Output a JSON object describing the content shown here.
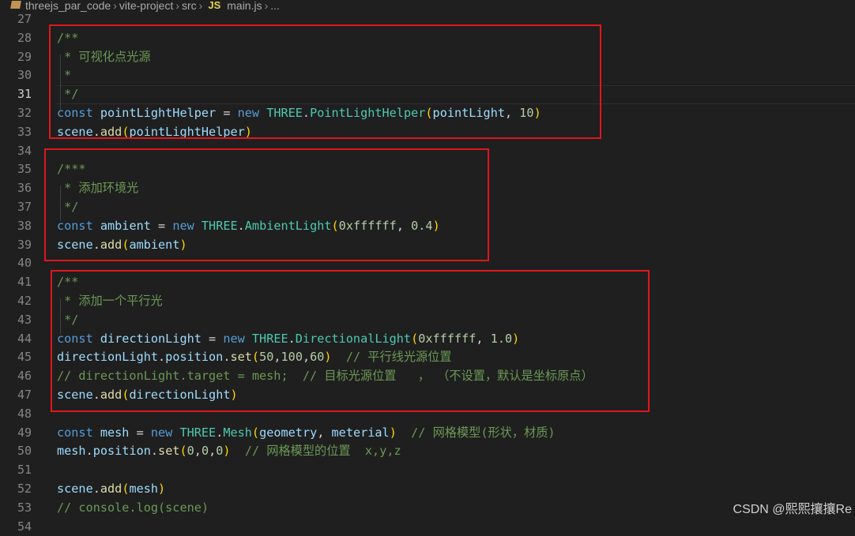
{
  "breadcrumb": {
    "project": "threejs_par_code",
    "folder": "vite-project",
    "subfolder": "src",
    "file_icon": "JS",
    "file": "main.js",
    "ellipsis": "..."
  },
  "editor": {
    "active_line": "31",
    "lines": [
      {
        "n": "27",
        "code": []
      },
      {
        "n": "28",
        "code": [
          [
            "c",
            "/**"
          ]
        ]
      },
      {
        "n": "29",
        "code": [
          [
            "c",
            " * 可视化点光源"
          ]
        ]
      },
      {
        "n": "30",
        "code": [
          [
            "c",
            " *"
          ]
        ]
      },
      {
        "n": "31",
        "code": [
          [
            "c",
            " */"
          ]
        ]
      },
      {
        "n": "32",
        "code": [
          [
            "k",
            "const "
          ],
          [
            "v",
            "pointLightHelper"
          ],
          [
            "o",
            " = "
          ],
          [
            "k",
            "new "
          ],
          [
            "t",
            "THREE"
          ],
          [
            "o",
            "."
          ],
          [
            "t",
            "PointLightHelper"
          ],
          [
            "p",
            "("
          ],
          [
            "v",
            "pointLight"
          ],
          [
            "o",
            ", "
          ],
          [
            "n",
            "10"
          ],
          [
            "p",
            ")"
          ]
        ]
      },
      {
        "n": "33",
        "code": [
          [
            "v",
            "scene"
          ],
          [
            "o",
            "."
          ],
          [
            "f",
            "add"
          ],
          [
            "p",
            "("
          ],
          [
            "v",
            "pointLightHelper"
          ],
          [
            "p",
            ")"
          ]
        ]
      },
      {
        "n": "34",
        "code": []
      },
      {
        "n": "35",
        "code": [
          [
            "c",
            "/***"
          ]
        ]
      },
      {
        "n": "36",
        "code": [
          [
            "c",
            " * 添加环境光"
          ]
        ]
      },
      {
        "n": "37",
        "code": [
          [
            "c",
            " */"
          ]
        ]
      },
      {
        "n": "38",
        "code": [
          [
            "k",
            "const "
          ],
          [
            "v",
            "ambient"
          ],
          [
            "o",
            " = "
          ],
          [
            "k",
            "new "
          ],
          [
            "t",
            "THREE"
          ],
          [
            "o",
            "."
          ],
          [
            "t",
            "AmbientLight"
          ],
          [
            "p",
            "("
          ],
          [
            "n",
            "0xffffff"
          ],
          [
            "o",
            ", "
          ],
          [
            "n",
            "0.4"
          ],
          [
            "p",
            ")"
          ]
        ]
      },
      {
        "n": "39",
        "code": [
          [
            "v",
            "scene"
          ],
          [
            "o",
            "."
          ],
          [
            "f",
            "add"
          ],
          [
            "p",
            "("
          ],
          [
            "v",
            "ambient"
          ],
          [
            "p",
            ")"
          ]
        ]
      },
      {
        "n": "40",
        "code": []
      },
      {
        "n": "41",
        "code": [
          [
            "c",
            "/**"
          ]
        ]
      },
      {
        "n": "42",
        "code": [
          [
            "c",
            " * 添加一个平行光"
          ]
        ]
      },
      {
        "n": "43",
        "code": [
          [
            "c",
            " */"
          ]
        ]
      },
      {
        "n": "44",
        "code": [
          [
            "k",
            "const "
          ],
          [
            "v",
            "directionLight"
          ],
          [
            "o",
            " = "
          ],
          [
            "k",
            "new "
          ],
          [
            "t",
            "THREE"
          ],
          [
            "o",
            "."
          ],
          [
            "t",
            "DirectionalLight"
          ],
          [
            "p",
            "("
          ],
          [
            "n",
            "0xffffff"
          ],
          [
            "o",
            ", "
          ],
          [
            "n",
            "1.0"
          ],
          [
            "p",
            ")"
          ]
        ]
      },
      {
        "n": "45",
        "code": [
          [
            "v",
            "directionLight"
          ],
          [
            "o",
            "."
          ],
          [
            "v",
            "position"
          ],
          [
            "o",
            "."
          ],
          [
            "f",
            "set"
          ],
          [
            "p",
            "("
          ],
          [
            "n",
            "50"
          ],
          [
            "o",
            ","
          ],
          [
            "n",
            "100"
          ],
          [
            "o",
            ","
          ],
          [
            "n",
            "60"
          ],
          [
            "p",
            ")"
          ],
          [
            "o",
            "  "
          ],
          [
            "c",
            "// 平行线光源位置"
          ]
        ]
      },
      {
        "n": "46",
        "code": [
          [
            "c",
            "// directionLight.target = mesh;  // 目标光源位置   ， （不设置，默认是坐标原点）"
          ]
        ]
      },
      {
        "n": "47",
        "code": [
          [
            "v",
            "scene"
          ],
          [
            "o",
            "."
          ],
          [
            "f",
            "add"
          ],
          [
            "p",
            "("
          ],
          [
            "v",
            "directionLight"
          ],
          [
            "p",
            ")"
          ]
        ]
      },
      {
        "n": "48",
        "code": []
      },
      {
        "n": "49",
        "code": [
          [
            "k",
            "const "
          ],
          [
            "v",
            "mesh"
          ],
          [
            "o",
            " = "
          ],
          [
            "k",
            "new "
          ],
          [
            "t",
            "THREE"
          ],
          [
            "o",
            "."
          ],
          [
            "t",
            "Mesh"
          ],
          [
            "p",
            "("
          ],
          [
            "v",
            "geometry"
          ],
          [
            "o",
            ", "
          ],
          [
            "v",
            "meterial"
          ],
          [
            "p",
            ")"
          ],
          [
            "o",
            "  "
          ],
          [
            "c",
            "// 网格模型(形状，材质)"
          ]
        ]
      },
      {
        "n": "50",
        "code": [
          [
            "v",
            "mesh"
          ],
          [
            "o",
            "."
          ],
          [
            "v",
            "position"
          ],
          [
            "o",
            "."
          ],
          [
            "f",
            "set"
          ],
          [
            "p",
            "("
          ],
          [
            "n",
            "0"
          ],
          [
            "o",
            ","
          ],
          [
            "n",
            "0"
          ],
          [
            "o",
            ","
          ],
          [
            "n",
            "0"
          ],
          [
            "p",
            ")"
          ],
          [
            "o",
            "  "
          ],
          [
            "c",
            "// 网格模型的位置  x,y,z"
          ]
        ]
      },
      {
        "n": "51",
        "code": []
      },
      {
        "n": "52",
        "code": [
          [
            "v",
            "scene"
          ],
          [
            "o",
            "."
          ],
          [
            "f",
            "add"
          ],
          [
            "p",
            "("
          ],
          [
            "v",
            "mesh"
          ],
          [
            "p",
            ")"
          ]
        ]
      },
      {
        "n": "53",
        "code": [
          [
            "c",
            "// console.log(scene)"
          ]
        ]
      },
      {
        "n": "54",
        "code": []
      }
    ]
  },
  "colors": {
    "highlight_box": "#e0161c",
    "background": "#1f1f1f"
  },
  "watermark": "CSDN @熙熙攘攘Re"
}
